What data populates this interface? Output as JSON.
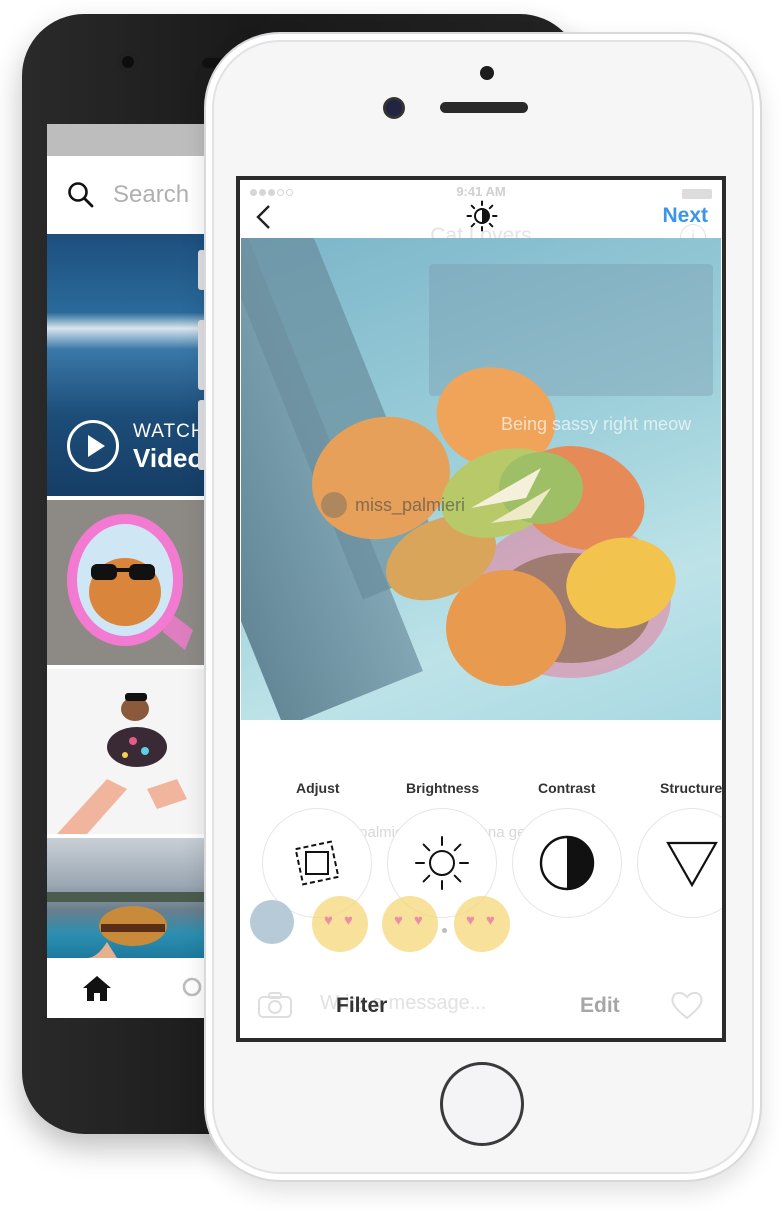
{
  "android": {
    "search_placeholder": "Search",
    "watch_label": "WATCH",
    "videos_label": "Videos"
  },
  "iphone": {
    "status_time": "9:41 AM",
    "next_label": "Next",
    "ghost_title": "Cat Lovers",
    "info_glyph": "i",
    "ghost_message": "Being sassy right meow",
    "ghost_username": "miss_palmieri",
    "ghost_comment": "miss_palmieri I don't wanna get up",
    "ghost_input_placeholder": "Write a message...",
    "tools": [
      {
        "label": "Adjust",
        "icon": "adjust-icon"
      },
      {
        "label": "Brightness",
        "icon": "brightness-icon"
      },
      {
        "label": "Contrast",
        "icon": "contrast-icon"
      },
      {
        "label": "Structure",
        "icon": "structure-icon"
      }
    ],
    "filter_tab": "Filter",
    "edit_tab": "Edit",
    "accent_color": "#3b95e8"
  }
}
